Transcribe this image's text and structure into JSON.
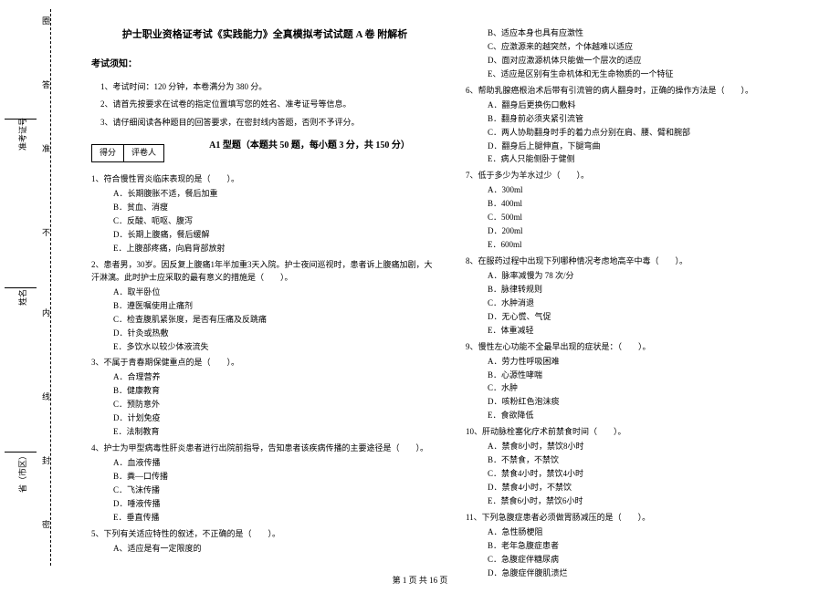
{
  "leftMargin": {
    "sealWords": [
      "圈",
      "答",
      "准",
      "不",
      "内",
      "线",
      "封",
      "密"
    ],
    "fields": [
      "准考证号",
      "姓名",
      "省（市区）"
    ]
  },
  "title": "护士职业资格证考试《实践能力》全真模拟考试试题 A 卷 附解析",
  "noticeHead": "考试须知：",
  "notices": [
    "1、考试时间：120 分钟，本卷满分为 380 分。",
    "2、请首先按要求在试卷的指定位置填写您的姓名、准考证号等信息。",
    "3、请仔细阅读各种题目的回答要求，在密封线内答题，否则不予评分。"
  ],
  "scoreLabels": [
    "得分",
    "评卷人"
  ],
  "qtypeHead": "A1 型题（本题共 50 题，每小题 3 分，共 150 分）",
  "colLeft": {
    "q1": {
      "stem": "1、符合慢性胃炎临床表现的是（　　）。",
      "opts": [
        "A．长期腹胀不适，餐后加重",
        "B．贫血、消瘦",
        "C．反酸、呃呕、腹泻",
        "D．长期上腹痛，餐后缓解",
        "E．上腹部疼痛，向肩背部放射"
      ]
    },
    "q2": {
      "stem": "2、患者男，30岁。因反复上腹痛1年半加重3天入院。护士夜间巡视时，患者诉上腹痛加剧，大汗淋漓。此时护士应采取的最有意义的措施是（　　）。",
      "opts": [
        "A．取半卧位",
        "B．遵医嘱使用止痛剂",
        "C．检查腹肌紧张度，是否有压痛及反跳痛",
        "D．针灸或热敷",
        "E．多饮水以较少体液流失"
      ]
    },
    "q3": {
      "stem": "3、不属于青春期保健重点的是（　　）。",
      "opts": [
        "A．合理营养",
        "B．健康教育",
        "C．预防意外",
        "D．计划免疫",
        "E．法制教育"
      ]
    },
    "q4": {
      "stem": "4、护士为甲型病毒性肝炎患者进行出院前指导，告知患者该疾病传播的主要途径是（　　）。",
      "opts": [
        "A．血液传播",
        "B．粪—口传播",
        "C．飞沫传播",
        "D．唾液传播",
        "E．垂直传播"
      ]
    },
    "q5": {
      "stem": "5、下列有关适应特性的叙述，不正确的是（　　）。",
      "opts": [
        "A、适应是有一定限度的"
      ]
    }
  },
  "colRight": {
    "q5opts": [
      "B、适应本身也具有应激性",
      "C、应激源来的越突然，个体越难以适应",
      "D、面对应激源机体只能做一个层次的适应",
      "E、适应是区别有生命机体和无生命物质的一个特征"
    ],
    "q6": {
      "stem": "6、帮助乳腺癌根治术后带有引流管的病人翻身时，正确的操作方法是（　　）。",
      "opts": [
        "A．翻身后更换伤口敷料",
        "B．翻身前必须夹紧引流管",
        "C．两人协助翻身时手的着力点分别在肩、腰、臂和腕部",
        "D．翻身后上腿伸直，下腿弯曲",
        "E．病人只能侧卧于健侧"
      ]
    },
    "q7": {
      "stem": "7、低于多少为羊水过少（　　）。",
      "opts": [
        "A．300ml",
        "B．400ml",
        "C．500ml",
        "D．200ml",
        "E．600ml"
      ]
    },
    "q8": {
      "stem": "8、在服药过程中出现下列哪种情况考虑地高辛中毒（　　）。",
      "opts": [
        "A．脉率减慢为 78 次/分",
        "B．脉律转规则",
        "C．水肿消退",
        "D．无心慌、气促",
        "E．体重减轻"
      ]
    },
    "q9": {
      "stem": "9、慢性左心功能不全最早出现的症状是：（　　）。",
      "opts": [
        "A．劳力性呼吸困难",
        "B．心源性哮喘",
        "C．水肿",
        "D．咳粉红色泡沫痰",
        "E．食欲降低"
      ]
    },
    "q10": {
      "stem": "10、肝动脉栓塞化疗术前禁食时间（　　）。",
      "opts": [
        "A．禁食8小时，禁饮8小时",
        "B．不禁食，不禁饮",
        "C．禁食4小时，禁饮4小时",
        "D．禁食4小时，不禁饮",
        "E．禁食6小时，禁饮6小时"
      ]
    },
    "q11": {
      "stem": "11、下列急腹症患者必须做胃肠减压的是（　　）。",
      "opts": [
        "A．急性肠梗阻",
        "B．老年急腹症患者",
        "C．急腹症伴糖尿病",
        "D．急腹症伴腹肌溃烂"
      ]
    }
  },
  "footer": "第 1 页 共 16 页"
}
